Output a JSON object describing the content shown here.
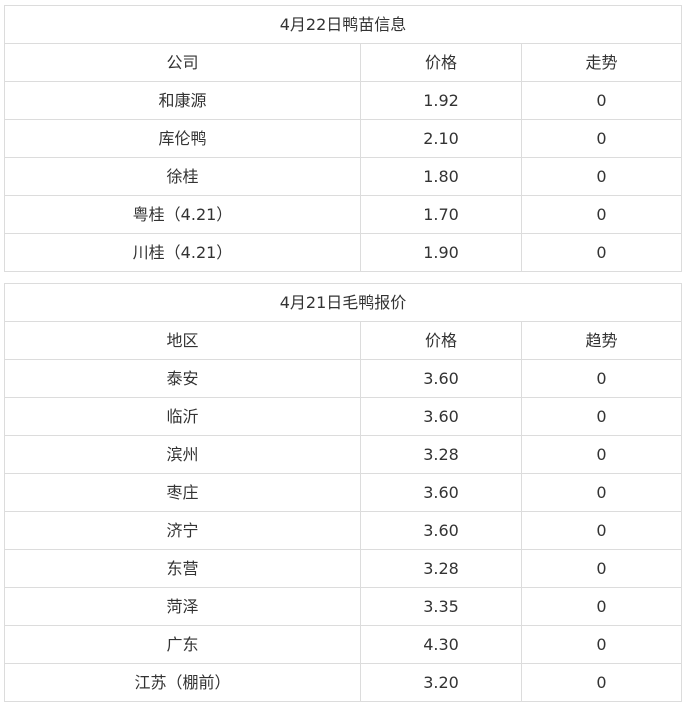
{
  "duckling_table": {
    "title": "4月22日鸭苗信息",
    "headers": [
      "公司",
      "价格",
      "走势"
    ],
    "rows": [
      [
        "和康源",
        "1.92",
        "0"
      ],
      [
        "库伦鸭",
        "2.10",
        "0"
      ],
      [
        "徐桂",
        "1.80",
        "0"
      ],
      [
        "粤桂（4.21）",
        "1.70",
        "0"
      ],
      [
        "川桂（4.21）",
        "1.90",
        "0"
      ]
    ]
  },
  "duck_table": {
    "title": "4月21日毛鸭报价",
    "headers": [
      "地区",
      "价格",
      "趋势"
    ],
    "rows": [
      [
        "泰安",
        "3.60",
        "0"
      ],
      [
        "临沂",
        "3.60",
        "0"
      ],
      [
        "滨州",
        "3.28",
        "0"
      ],
      [
        "枣庄",
        "3.60",
        "0"
      ],
      [
        "济宁",
        "3.60",
        "0"
      ],
      [
        "东营",
        "3.28",
        "0"
      ],
      [
        "菏泽",
        "3.35",
        "0"
      ],
      [
        "广东",
        "4.30",
        "0"
      ],
      [
        "江苏（棚前）",
        "3.20",
        "0"
      ]
    ]
  }
}
